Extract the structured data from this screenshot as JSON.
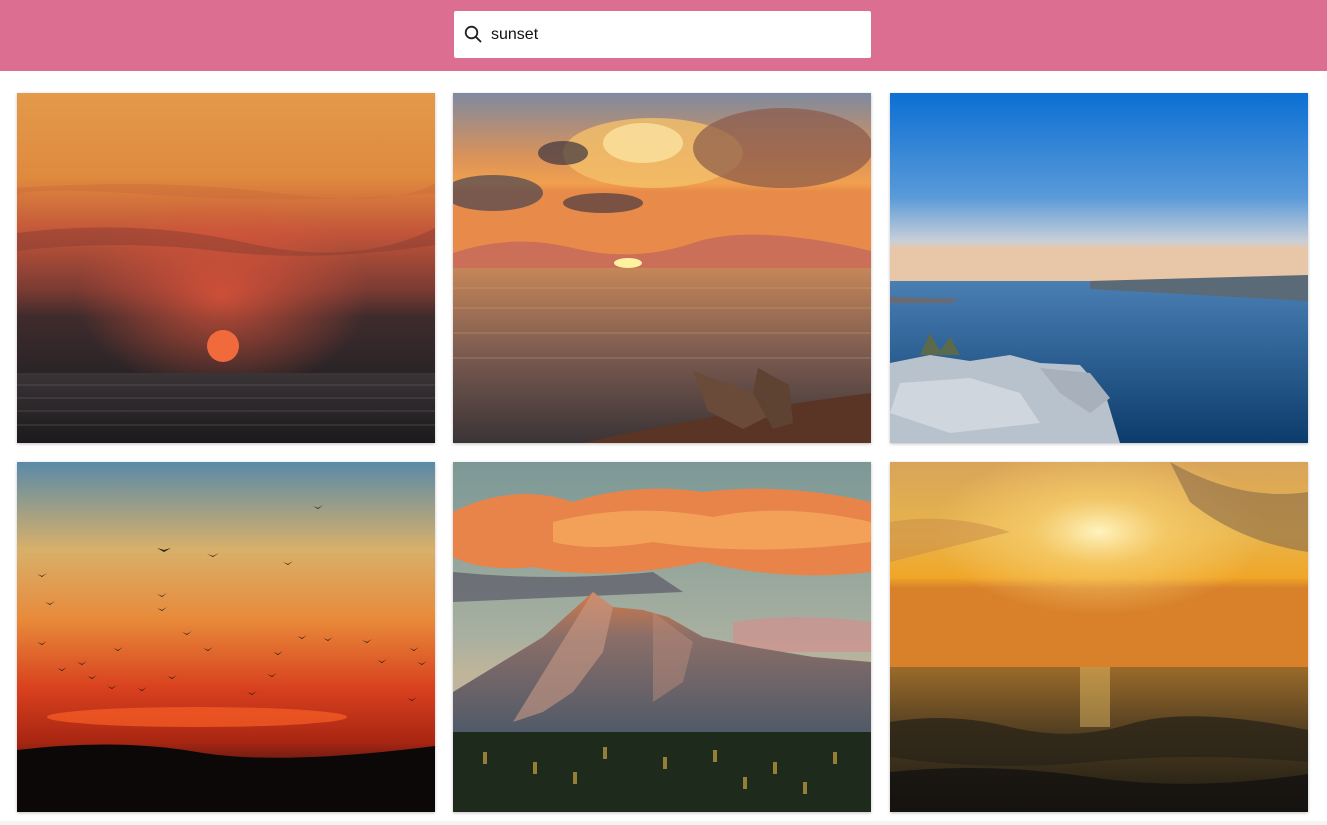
{
  "search": {
    "value": "sunset",
    "icon": "search-icon"
  },
  "colors": {
    "header": "#dc6e92",
    "search_bg": "#ffffff"
  },
  "images": [
    {
      "subject": "sun-over-sea"
    },
    {
      "subject": "boats-at-sunset-shore"
    },
    {
      "subject": "blue-lake-rocky-shore"
    },
    {
      "subject": "birds-in-red-sunset"
    },
    {
      "subject": "mountain-at-sunset"
    },
    {
      "subject": "golden-sun-over-waves"
    }
  ]
}
